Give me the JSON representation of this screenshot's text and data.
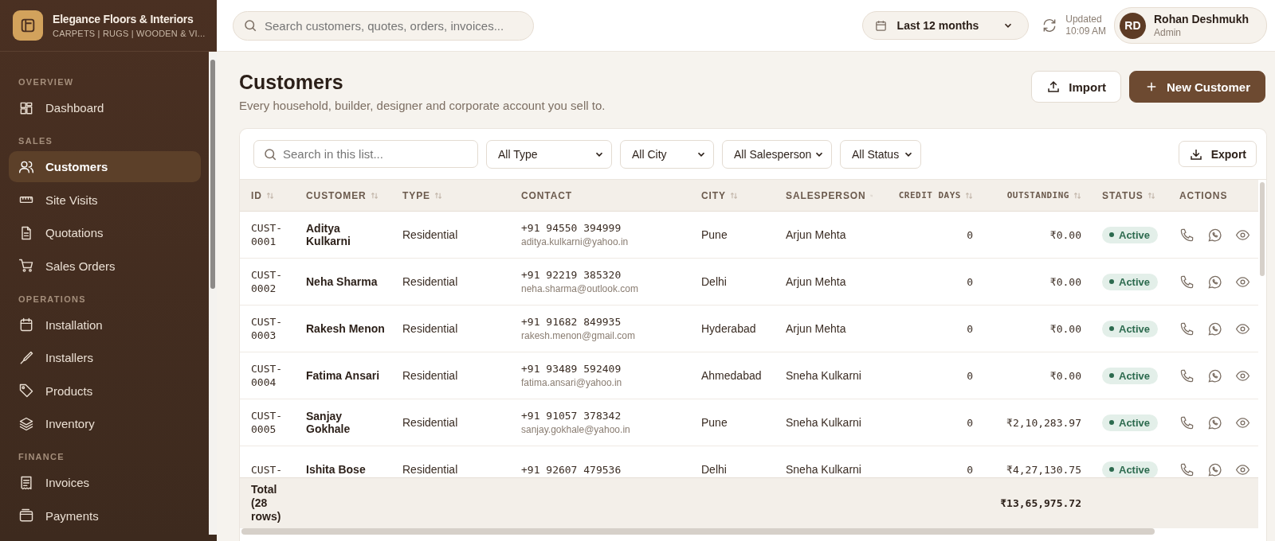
{
  "brand": {
    "name": "Elegance Floors & Interiors",
    "tagline": "CARPETS | RUGS | WOODEN & VI..."
  },
  "topbar": {
    "search_placeholder": "Search customers, quotes, orders, invoices...",
    "period": "Last 12 months",
    "updated_label": "Updated",
    "updated_time": "10:09 AM",
    "user": {
      "initials": "RD",
      "name": "Rohan Deshmukh",
      "role": "Admin"
    }
  },
  "sidebar": {
    "sections": [
      {
        "title": "OVERVIEW",
        "items": [
          {
            "label": "Dashboard",
            "selected": false
          }
        ]
      },
      {
        "title": "SALES",
        "items": [
          {
            "label": "Customers",
            "selected": true
          },
          {
            "label": "Site Visits",
            "selected": false
          },
          {
            "label": "Quotations",
            "selected": false
          },
          {
            "label": "Sales Orders",
            "selected": false
          }
        ]
      },
      {
        "title": "OPERATIONS",
        "items": [
          {
            "label": "Installation",
            "selected": false
          },
          {
            "label": "Installers",
            "selected": false
          },
          {
            "label": "Products",
            "selected": false
          },
          {
            "label": "Inventory",
            "selected": false
          }
        ]
      },
      {
        "title": "FINANCE",
        "items": [
          {
            "label": "Invoices",
            "selected": false
          },
          {
            "label": "Payments",
            "selected": false
          }
        ]
      }
    ]
  },
  "page": {
    "title": "Customers",
    "subtitle": "Every household, builder, designer and corporate account you sell to.",
    "buttons": [
      {
        "label": "Import",
        "kind": "secondary"
      },
      {
        "label": "New Customer",
        "kind": "primary"
      }
    ]
  },
  "toolbar": {
    "search_placeholder": "Search in this list...",
    "filters": [
      "All Type",
      "All City",
      "All Salesperson",
      "All Status"
    ],
    "export": "Export"
  },
  "table": {
    "columns": [
      {
        "label": "ID",
        "sortable": true,
        "kind": "text"
      },
      {
        "label": "CUSTOMER",
        "sortable": true,
        "kind": "text"
      },
      {
        "label": "TYPE",
        "sortable": true,
        "kind": "text"
      },
      {
        "label": "CONTACT",
        "sortable": false,
        "kind": "text"
      },
      {
        "label": "CITY",
        "sortable": true,
        "kind": "text"
      },
      {
        "label": "SALESPERSON",
        "sortable": true,
        "kind": "text"
      },
      {
        "label": "CREDIT DAYS",
        "sortable": true,
        "kind": "number"
      },
      {
        "label": "OUTSTANDING",
        "sortable": true,
        "kind": "number"
      },
      {
        "label": "STATUS",
        "sortable": true,
        "kind": "text"
      },
      {
        "label": "ACTIONS",
        "sortable": false,
        "kind": "text"
      }
    ],
    "rows": [
      {
        "id": "CUST-0001",
        "customer": "Aditya Kulkarni",
        "type": "Residential",
        "phone": "+91 94550 394999",
        "email": "aditya.kulkarni@yahoo.in",
        "city": "Pune",
        "salesperson": "Arjun Mehta",
        "credit_days": "0",
        "outstanding": "₹0.00",
        "status": "Active"
      },
      {
        "id": "CUST-0002",
        "customer": "Neha Sharma",
        "type": "Residential",
        "phone": "+91 92219 385320",
        "email": "neha.sharma@outlook.com",
        "city": "Delhi",
        "salesperson": "Arjun Mehta",
        "credit_days": "0",
        "outstanding": "₹0.00",
        "status": "Active"
      },
      {
        "id": "CUST-0003",
        "customer": "Rakesh Menon",
        "type": "Residential",
        "phone": "+91 91682 849935",
        "email": "rakesh.menon@gmail.com",
        "city": "Hyderabad",
        "salesperson": "Arjun Mehta",
        "credit_days": "0",
        "outstanding": "₹0.00",
        "status": "Active"
      },
      {
        "id": "CUST-0004",
        "customer": "Fatima Ansari",
        "type": "Residential",
        "phone": "+91 93489 592409",
        "email": "fatima.ansari@yahoo.in",
        "city": "Ahmedabad",
        "salesperson": "Sneha Kulkarni",
        "credit_days": "0",
        "outstanding": "₹0.00",
        "status": "Active"
      },
      {
        "id": "CUST-0005",
        "customer": "Sanjay Gokhale",
        "type": "Residential",
        "phone": "+91 91057 378342",
        "email": "sanjay.gokhale@yahoo.in",
        "city": "Pune",
        "salesperson": "Sneha Kulkarni",
        "credit_days": "0",
        "outstanding": "₹2,10,283.97",
        "status": "Active"
      },
      {
        "id": "CUST-",
        "customer": "Ishita Bose",
        "type": "Residential",
        "phone": "+91 92607 479536",
        "city": "Delhi",
        "salesperson": "Sneha Kulkarni",
        "credit_days": "0",
        "outstanding": "₹4,27,130.75",
        "status": "Active"
      }
    ],
    "footer": {
      "label": "Total (28 rows)",
      "outstanding": "₹13,65,975.72"
    }
  }
}
